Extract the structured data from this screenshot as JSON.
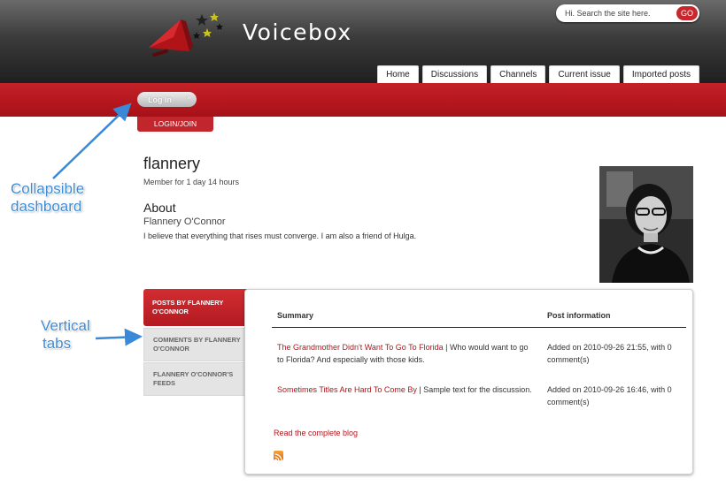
{
  "site": {
    "name": "Voicebox"
  },
  "search": {
    "placeholder": "Hi. Search the site here.",
    "button": "GO"
  },
  "nav": {
    "tabs": [
      "Home",
      "Discussions",
      "Channels",
      "Current issue",
      "Imported posts"
    ]
  },
  "dashboard": {
    "login_button": "Log In",
    "login_tab": "LOGIN/JOIN"
  },
  "annotations": {
    "dashboard": [
      "Collapsible",
      "dashboard"
    ],
    "vertical_tabs": [
      "Vertical",
      "tabs"
    ]
  },
  "profile": {
    "username": "flannery",
    "member_for": "Member for  1 day 14 hours",
    "about_heading": "About",
    "full_name": "Flannery O'Connor",
    "bio": "I believe that everything that rises must converge. I am also a friend of Hulga."
  },
  "vertical_tabs": [
    "POSTS BY FLANNERY O'CONNOR",
    "COMMENTS BY FLANNERY O'CONNOR",
    "FLANNERY O'CONNOR'S FEEDS"
  ],
  "posts_table": {
    "headers": {
      "summary": "Summary",
      "info": "Post information"
    },
    "rows": [
      {
        "title": "The Grandmother Didn't Want To Go To Florida",
        "excerpt": " | Who would want to go to Florida? And especially with those kids.",
        "info": "Added on 2010-09-26 21:55, with 0 comment(s)"
      },
      {
        "title": "Sometimes Titles Are Hard To Come By",
        "excerpt": " | Sample text for the discussion.",
        "info": "Added on 2010-09-26 16:46, with 0 comment(s)"
      }
    ],
    "read_more": "Read the complete blog"
  },
  "colors": {
    "brand_red": "#b5161e",
    "link_red": "#b3151c",
    "annotation_blue": "#3f8bd6",
    "header_dark": "#2a2a2a"
  }
}
